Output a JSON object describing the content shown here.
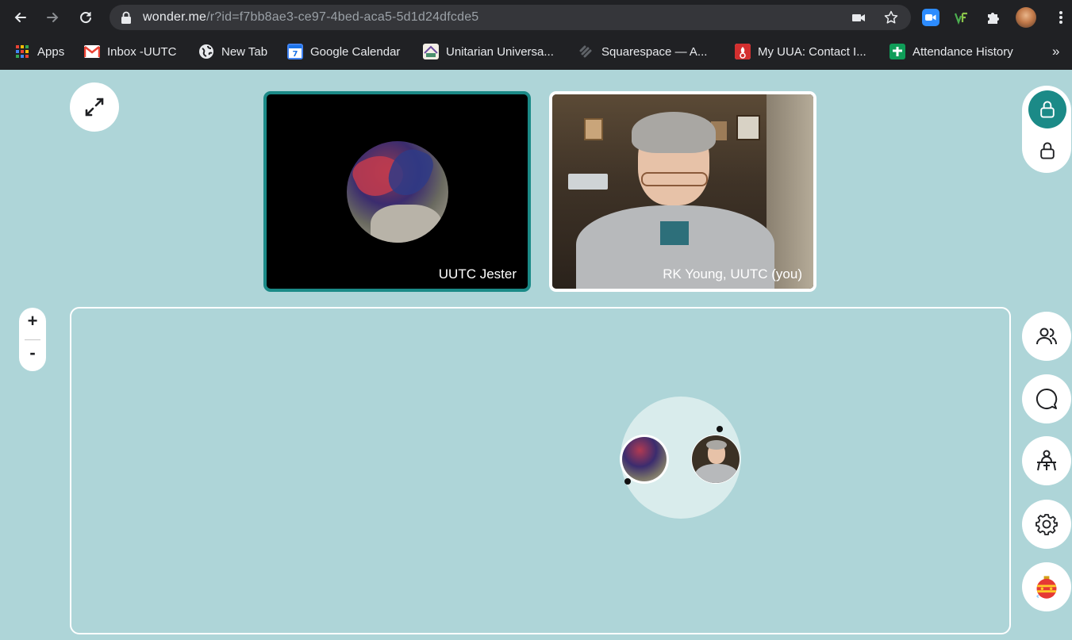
{
  "browser": {
    "url_host": "wonder.me",
    "url_path": "/r?id=f7bb8ae3-ce97-4bed-aca5-5d1d24dfcde5",
    "icons": [
      "back-arrow-icon",
      "forward-arrow-icon",
      "reload-icon",
      "lock-icon",
      "camera-icon",
      "star-icon",
      "puzzle-icon",
      "menu-dots-icon"
    ],
    "bookmarks": [
      {
        "label": "Apps",
        "icon": "apps-grid-icon"
      },
      {
        "label": "Inbox -UUTC",
        "icon": "gmail-icon"
      },
      {
        "label": "New Tab",
        "icon": "globe-icon"
      },
      {
        "label": "Google Calendar",
        "icon": "calendar-icon"
      },
      {
        "label": "Unitarian Universa...",
        "icon": "uutc-icon"
      },
      {
        "label": "Squarespace — A...",
        "icon": "squarespace-icon"
      },
      {
        "label": "My UUA: Contact I...",
        "icon": "uua-icon"
      },
      {
        "label": "Attendance History",
        "icon": "plus-icon"
      }
    ],
    "overflow_label": "»"
  },
  "app": {
    "tiles": [
      {
        "name": "UUTC Jester"
      },
      {
        "name": "RK Young, UUTC (you)"
      }
    ],
    "zoom": {
      "in_label": "+",
      "out_label": "-"
    },
    "side_buttons": [
      "people-icon",
      "chat-icon",
      "desk-icon",
      "gear-icon",
      "ornament-icon"
    ],
    "colors": {
      "background": "#aed5d8",
      "accent": "#1b8a87",
      "chrome": "#202124"
    }
  }
}
